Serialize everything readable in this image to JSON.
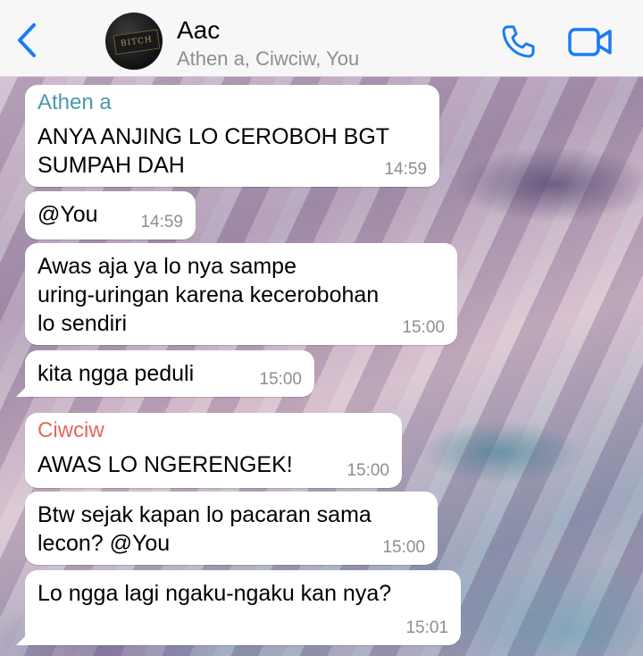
{
  "header": {
    "title": "Aac",
    "subtitle": "Athen a, Ciwciw, You",
    "avatar_text": "BITCH",
    "back_icon": "chevron-left-icon",
    "call_icon": "phone-icon",
    "video_icon": "video-camera-icon",
    "accent_color": "#1a7cf2"
  },
  "messages": [
    {
      "sender": "Athen a",
      "sender_color": "#4a9aa8",
      "text": "ANYA ANJING LO CEROBOH BGT\nSUMPAH DAH",
      "time": "14:59"
    },
    {
      "text": "@You",
      "time": "14:59"
    },
    {
      "text": "Awas aja ya lo nya sampe\nuring-uringan karena kecerobohan\nlo sendiri",
      "time": "15:00"
    },
    {
      "text": "kita ngga peduli",
      "time": "15:00"
    },
    {
      "sender": "Ciwciw",
      "sender_color": "#e5665e",
      "text": "AWAS LO NGERENGEK!",
      "time": "15:00"
    },
    {
      "text": "Btw sejak kapan lo pacaran sama\nlecon? @You",
      "time": "15:00"
    },
    {
      "text": "Lo ngga lagi ngaku-ngaku kan nya?",
      "time": "15:01"
    }
  ]
}
